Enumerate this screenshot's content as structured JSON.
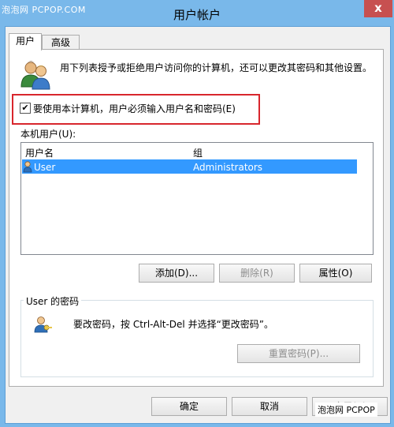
{
  "watermark": {
    "top": "泡泡网 PCPOP.COM",
    "bottom": "泡泡网  PCPOP"
  },
  "window": {
    "title": "用户帐户",
    "close_label": "x"
  },
  "tabs": [
    {
      "label": "用户"
    },
    {
      "label": "高级"
    }
  ],
  "intro": "用下列表授予或拒绝用户访问你的计算机，还可以更改其密码和其他设置。",
  "checkbox": {
    "checked": true,
    "mark": "✔",
    "label": "要使用本计算机，用户必须输入用户名和密码(E)"
  },
  "user_list": {
    "label": "本机用户(U):",
    "columns": [
      "用户名",
      "组"
    ],
    "rows": [
      {
        "name": "User",
        "group": "Administrators"
      }
    ]
  },
  "buttons": {
    "add": "添加(D)...",
    "remove": "删除(R)",
    "properties": "属性(O)"
  },
  "password_group": {
    "title": "User 的密码",
    "text": "要改密码，按 Ctrl-Alt-Del 并选择“更改密码”。",
    "reset": "重置密码(P)..."
  },
  "footer": {
    "ok": "确定",
    "cancel": "取消",
    "apply": "应用(A)"
  },
  "colors": {
    "title_bar": "#79b8ea",
    "selection": "#3399ff",
    "highlight": "#d8262d",
    "close": "#c75050"
  }
}
